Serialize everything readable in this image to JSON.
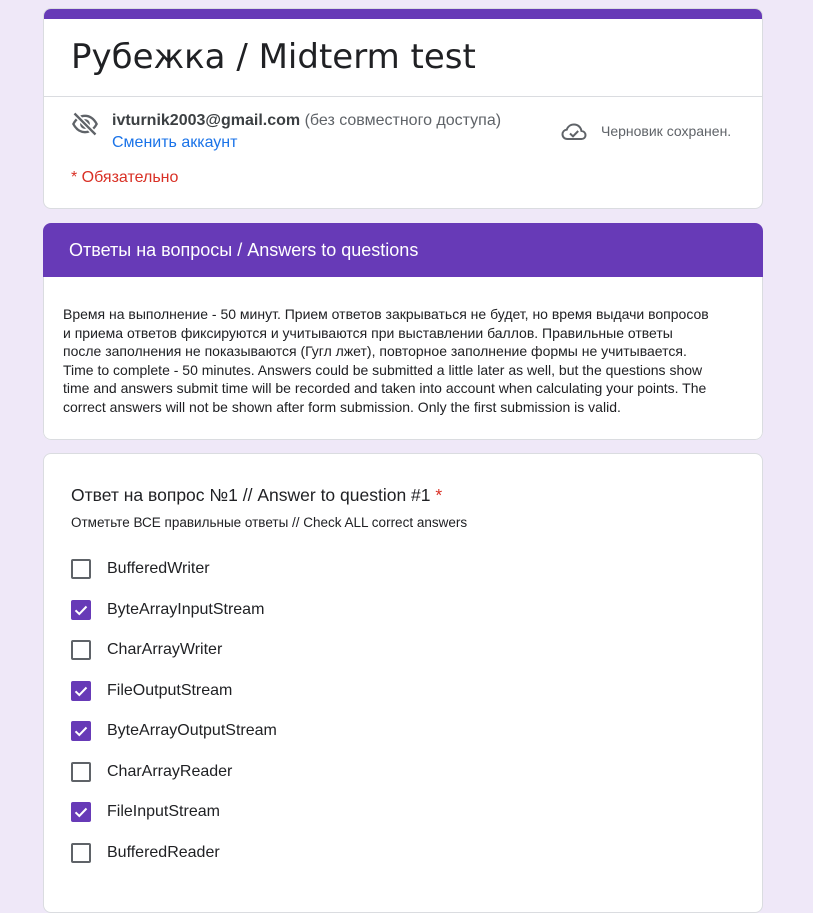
{
  "form": {
    "title": "Рубежка / Midterm test",
    "account_email": "ivturnik2003@gmail.com",
    "account_sharing": "(без совместного доступа)",
    "switch_account": "Сменить аккаунт",
    "draft_status": "Черновик сохранен.",
    "required_note": "* Обязательно"
  },
  "section": {
    "title": "Ответы на вопросы / Answers to questions",
    "description": "Время на выполнение - 50 минут. Прием ответов закрываться не будет, но время выдачи вопросов\nи приема ответов фиксируются и учитываются при выставлении баллов. Правильные ответы\nпосле заполнения не показываются (Гугл лжет), повторное заполнение формы не учитывается.\nTime to complete - 50 minutes. Answers could be submitted a little later as well, but the questions show\ntime and answers submit time will be recorded and taken into account when calculating your points. The\ncorrect answers will not be shown after form submission. Only the first submission is valid."
  },
  "question": {
    "title": "Ответ на вопрос №1 // Answer to question #1",
    "required_mark": "*",
    "help": "Отметьте ВСЕ правильные ответы // Check ALL correct answers",
    "options": [
      {
        "label": "BufferedWriter",
        "checked": false
      },
      {
        "label": "ByteArrayInputStream",
        "checked": true
      },
      {
        "label": "CharArrayWriter",
        "checked": false
      },
      {
        "label": "FileOutputStream",
        "checked": true
      },
      {
        "label": "ByteArrayOutputStream",
        "checked": true
      },
      {
        "label": "CharArrayReader",
        "checked": false
      },
      {
        "label": "FileInputStream",
        "checked": true
      },
      {
        "label": "BufferedReader",
        "checked": false
      }
    ]
  },
  "colors": {
    "accent": "#673ab7",
    "background": "#efe8f8",
    "link": "#1a73e8",
    "required": "#d93025"
  },
  "icons": {
    "visibility": "visibility-off-icon",
    "save_status": "cloud-done-icon",
    "check": "check-icon"
  }
}
